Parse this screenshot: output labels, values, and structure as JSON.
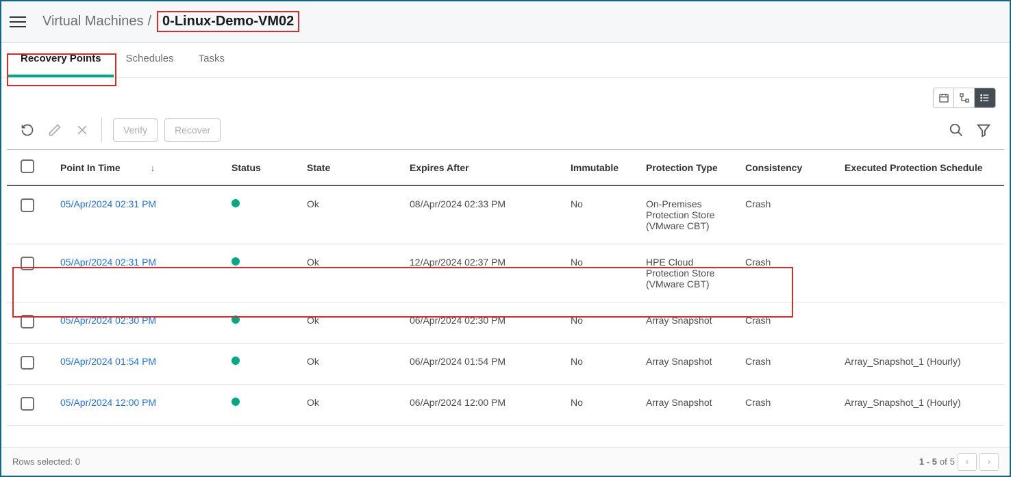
{
  "breadcrumb": {
    "parent": "Virtual Machines",
    "separator": "/",
    "current": "0-Linux-Demo-VM02"
  },
  "tabs": {
    "recovery": "Recovery Points",
    "schedules": "Schedules",
    "tasks": "Tasks"
  },
  "toolbar": {
    "verify": "Verify",
    "recover": "Recover"
  },
  "columns": {
    "point": "Point In Time",
    "status": "Status",
    "state": "State",
    "expires": "Expires After",
    "immutable": "Immutable",
    "ptype": "Protection Type",
    "consistency": "Consistency",
    "schedule": "Executed Protection Schedule"
  },
  "rows": [
    {
      "point": "05/Apr/2024 02:31 PM",
      "state": "Ok",
      "expires": "08/Apr/2024 02:33 PM",
      "immutable": "No",
      "ptype": "On-Premises Protection Store (VMware CBT)",
      "consistency": "Crash",
      "schedule": ""
    },
    {
      "point": "05/Apr/2024 02:31 PM",
      "state": "Ok",
      "expires": "12/Apr/2024 02:37 PM",
      "immutable": "No",
      "ptype": "HPE Cloud Protection Store (VMware CBT)",
      "consistency": "Crash",
      "schedule": ""
    },
    {
      "point": "05/Apr/2024 02:30 PM",
      "state": "Ok",
      "expires": "06/Apr/2024 02:30 PM",
      "immutable": "No",
      "ptype": "Array Snapshot",
      "consistency": "Crash",
      "schedule": ""
    },
    {
      "point": "05/Apr/2024 01:54 PM",
      "state": "Ok",
      "expires": "06/Apr/2024 01:54 PM",
      "immutable": "No",
      "ptype": "Array Snapshot",
      "consistency": "Crash",
      "schedule": "Array_Snapshot_1 (Hourly)"
    },
    {
      "point": "05/Apr/2024 12:00 PM",
      "state": "Ok",
      "expires": "06/Apr/2024 12:00 PM",
      "immutable": "No",
      "ptype": "Array Snapshot",
      "consistency": "Crash",
      "schedule": "Array_Snapshot_1 (Hourly)"
    }
  ],
  "footer": {
    "rowsSelected": "Rows selected: 0",
    "range": "1 - 5",
    "of": "of",
    "total": "5"
  }
}
